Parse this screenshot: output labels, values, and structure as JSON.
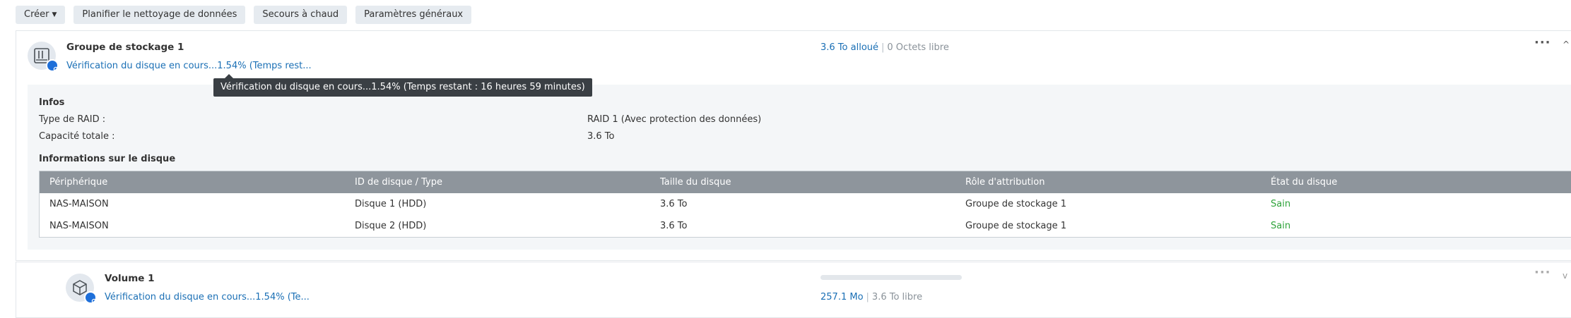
{
  "toolbar": {
    "create_label": "Créer",
    "schedule_label": "Planifier le nettoyage de données",
    "hotspare_label": "Secours à chaud",
    "settings_label": "Paramètres généraux"
  },
  "pool": {
    "title": "Groupe de stockage 1",
    "status": "Vérification du disque en cours...1.54% (Temps rest...",
    "usage_allocated": "3.6 To alloué",
    "usage_separator": "|",
    "usage_free": "0 Octets libre",
    "tooltip": "Vérification du disque en cours...1.54% (Temps restant : 16 heures 59 minutes)",
    "menu": "···",
    "collapse": "^",
    "info": {
      "title": "Infos",
      "raid_label": "Type de RAID :",
      "raid_value": "RAID 1 (Avec protection des données)",
      "capacity_label": "Capacité totale :",
      "capacity_value": "3.6 To"
    },
    "disks": {
      "title": "Informations sur le disque",
      "headers": [
        "Périphérique",
        "ID de disque / Type",
        "Taille du disque",
        "Rôle d'attribution",
        "État du disque"
      ],
      "rows": [
        [
          "NAS-MAISON",
          "Disque 1 (HDD)",
          "3.6 To",
          "Groupe de stockage 1",
          "Sain"
        ],
        [
          "NAS-MAISON",
          "Disque 2 (HDD)",
          "3.6 To",
          "Groupe de stockage 1",
          "Sain"
        ]
      ]
    }
  },
  "volume": {
    "title": "Volume 1",
    "status": "Vérification du disque en cours...1.54% (Te...",
    "usage_used": "257.1 Mo",
    "usage_separator": "|",
    "usage_total": "3.6 To libre",
    "usage_fraction": 0.0001,
    "menu": "···",
    "expand": "v"
  },
  "colors": {
    "accent": "#1a6fb5",
    "healthy": "#2ea33a",
    "table_header": "#8e959c",
    "tooltip_bg": "#3a3f44"
  }
}
